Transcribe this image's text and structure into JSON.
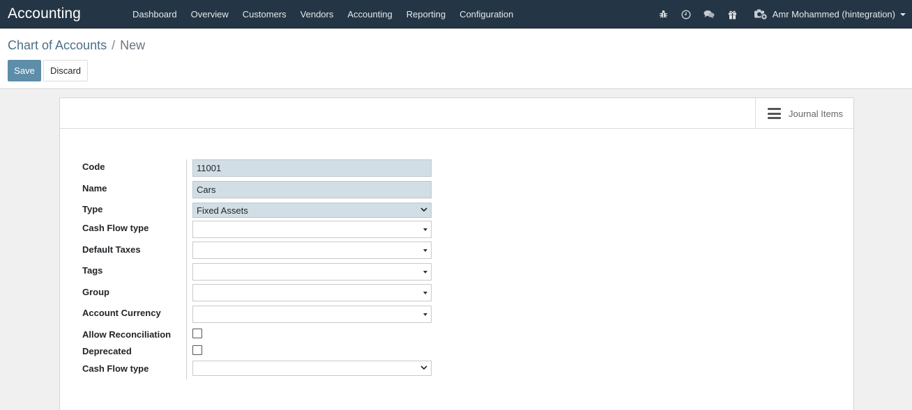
{
  "app": {
    "title": "Accounting"
  },
  "nav": {
    "items": [
      {
        "label": "Dashboard"
      },
      {
        "label": "Overview"
      },
      {
        "label": "Customers"
      },
      {
        "label": "Vendors"
      },
      {
        "label": "Accounting"
      },
      {
        "label": "Reporting"
      },
      {
        "label": "Configuration"
      }
    ],
    "icons": [
      "bug-icon",
      "clock-icon",
      "chat-icon",
      "gift-icon"
    ],
    "user": {
      "name": "Amr Mohammed (hintegration)"
    }
  },
  "breadcrumb": {
    "parent": "Chart of Accounts",
    "separator": "/",
    "current": "New"
  },
  "buttons": {
    "save": "Save",
    "discard": "Discard"
  },
  "smart_button": {
    "label": "Journal Items",
    "icon": "bars-icon"
  },
  "form": {
    "code": {
      "label": "Code",
      "value": "11001"
    },
    "name": {
      "label": "Name",
      "value": "Cars"
    },
    "type": {
      "label": "Type",
      "value": "Fixed Assets"
    },
    "cash_flow_type_1": {
      "label": "Cash Flow type",
      "value": ""
    },
    "default_taxes": {
      "label": "Default Taxes",
      "value": ""
    },
    "tags": {
      "label": "Tags",
      "value": ""
    },
    "group": {
      "label": "Group",
      "value": ""
    },
    "account_currency": {
      "label": "Account Currency",
      "value": ""
    },
    "allow_reconciliation": {
      "label": "Allow Reconciliation",
      "checked": false
    },
    "deprecated": {
      "label": "Deprecated",
      "checked": false
    },
    "cash_flow_type_2": {
      "label": "Cash Flow type",
      "value": ""
    }
  },
  "colors": {
    "navbar": "#243645",
    "primary": "#5d8da8",
    "required_field": "#d2dee5",
    "link": "#4b6f86"
  }
}
